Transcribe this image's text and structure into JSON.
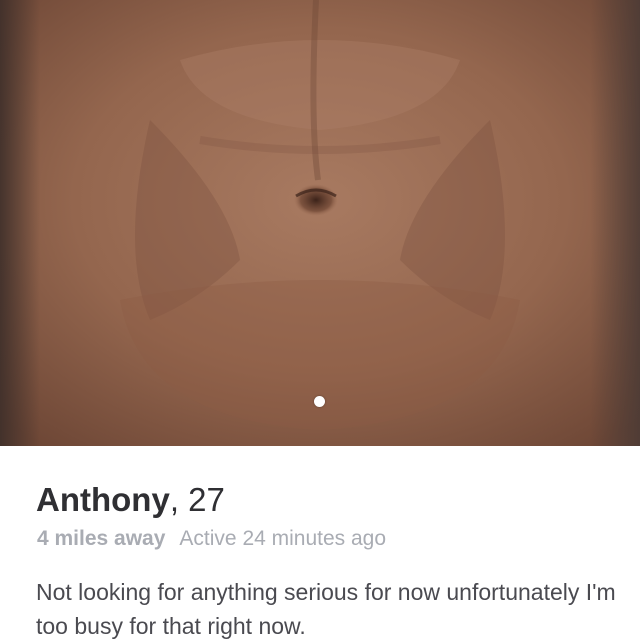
{
  "profile": {
    "name": "Anthony",
    "age_text": ", 27",
    "distance": "4 miles away",
    "last_active": "Active 24 minutes ago",
    "bio": "Not looking for anything serious for now unfortunately I'm too busy for that right now."
  },
  "photo": {
    "description_icon": "profile-photo",
    "page_indicator": {
      "current": 1,
      "total": 1
    }
  },
  "colors": {
    "name_text": "#2f2f33",
    "meta_text": "#a9acb3",
    "bio_text": "#4a4a50",
    "background": "#ffffff"
  }
}
